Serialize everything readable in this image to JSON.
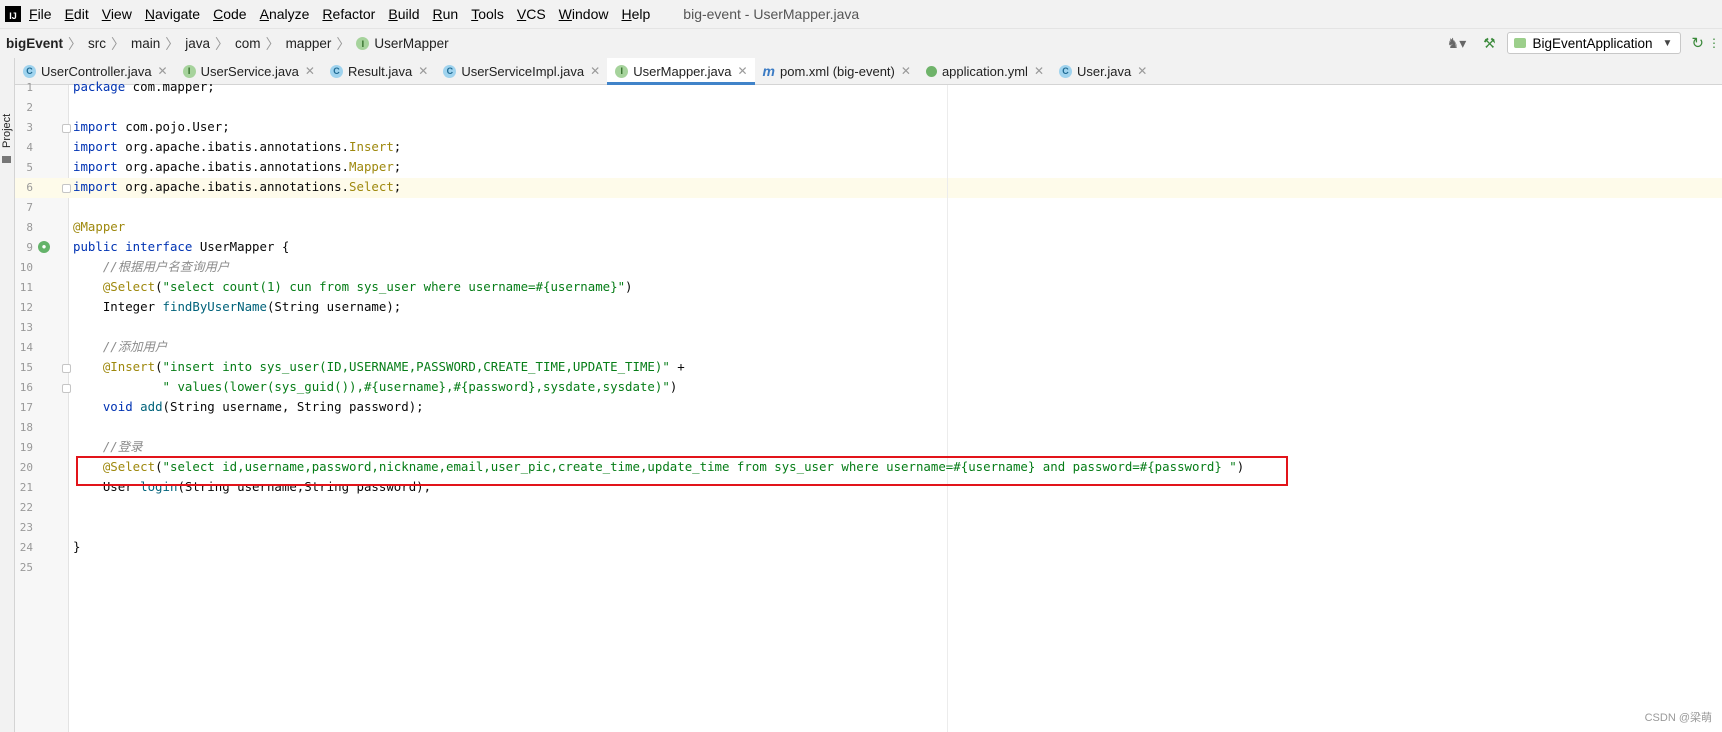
{
  "app": {
    "logo_text": "IJ",
    "window_title": "big-event - UserMapper.java"
  },
  "menu": [
    "File",
    "Edit",
    "View",
    "Navigate",
    "Code",
    "Analyze",
    "Refactor",
    "Build",
    "Run",
    "Tools",
    "VCS",
    "Window",
    "Help"
  ],
  "breadcrumb": {
    "project": "bigEvent",
    "path": [
      "src",
      "main",
      "java",
      "com",
      "mapper"
    ],
    "file": "UserMapper"
  },
  "toolbar": {
    "run_config": "BigEventApplication",
    "icons": [
      "user-icon",
      "hammer-icon",
      "rerun-icon"
    ]
  },
  "side_strip": {
    "project_label": "Project"
  },
  "tabs": [
    {
      "label": "UserController.java",
      "icon": "class-icon",
      "active": false
    },
    {
      "label": "UserService.java",
      "icon": "interface-icon",
      "active": false
    },
    {
      "label": "Result.java",
      "icon": "class-icon",
      "active": false
    },
    {
      "label": "UserServiceImpl.java",
      "icon": "class-icon",
      "active": false
    },
    {
      "label": "UserMapper.java",
      "icon": "interface-icon",
      "active": true
    },
    {
      "label": "pom.xml (big-event)",
      "icon": "maven-icon",
      "active": false
    },
    {
      "label": "application.yml",
      "icon": "yml-icon",
      "active": false
    },
    {
      "label": "User.java",
      "icon": "class-icon",
      "active": false
    }
  ],
  "editor": {
    "current_line": 6,
    "highlighted_line": 20,
    "line_numbers": [
      "1",
      "2",
      "3",
      "4",
      "5",
      "6",
      "7",
      "8",
      "9",
      "10",
      "11",
      "12",
      "13",
      "14",
      "15",
      "16",
      "17",
      "18",
      "19",
      "20",
      "21",
      "22",
      "23",
      "24",
      "25"
    ],
    "code": {
      "l1_kw": "package",
      "l1_rest": " com.mapper;",
      "l3_kw": "import",
      "l3_rest": " com.pojo.User;",
      "l4_kw": "import",
      "l4_rest": " org.apache.ibatis.annotations.",
      "l4_ann": "Insert",
      "l4_end": ";",
      "l5_kw": "import",
      "l5_rest": " org.apache.ibatis.annotations.",
      "l5_ann": "Mapper",
      "l5_end": ";",
      "l6_kw": "import",
      "l6_rest": " org.apache.ibatis.annotations.",
      "l6_ann": "Select",
      "l6_end": ";",
      "l8_ann": "@Mapper",
      "l9_kw": "public interface",
      "l9_rest": " UserMapper {",
      "l10_cmt": "    //根据用户名查询用户",
      "l11_indent": "    ",
      "l11_ann": "@Select",
      "l11_open": "(",
      "l11_str": "\"select count(1) cun from sys_user where username=#{username}\"",
      "l11_close": ")",
      "l12_pre": "    Integer ",
      "l12_fn": "findByUserName",
      "l12_post": "(String username);",
      "l14_cmt": "    //添加用户",
      "l15_indent": "    ",
      "l15_ann": "@Insert",
      "l15_open": "(",
      "l15_str": "\"insert into sys_user(ID,USERNAME,PASSWORD,CREATE_TIME,UPDATE_TIME)\"",
      "l15_post": " +",
      "l16_indent": "            ",
      "l16_str": "\" values(lower(sys_guid()),#{username},#{password},sysdate,sysdate)\"",
      "l16_close": ")",
      "l17_indent": "    ",
      "l17_kw": "void",
      "l17_sp": " ",
      "l17_fn": "add",
      "l17_post": "(String username, String password);",
      "l19_cmt": "    //登录",
      "l20_indent": "    ",
      "l20_ann": "@Select",
      "l20_open": "(",
      "l20_str": "\"select id,username,password,nickname,email,user_pic,create_time,update_time from sys_user where username=#{username} and password=#{password} \"",
      "l20_close": ")",
      "l21_pre": "    User ",
      "l21_fn": "login",
      "l21_post": "(String username,String password);",
      "l24": "}"
    }
  },
  "watermark": "CSDN @梁萌"
}
